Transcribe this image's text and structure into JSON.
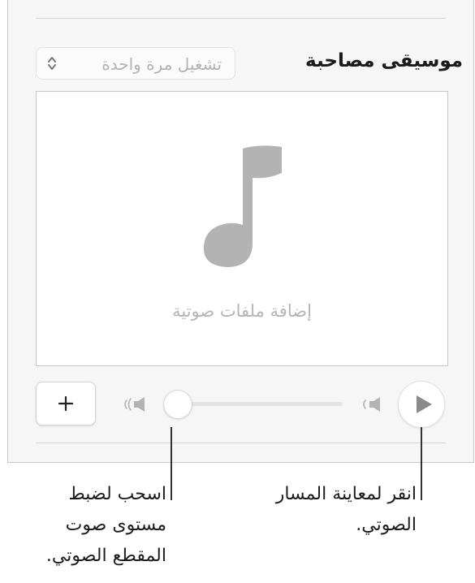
{
  "section": {
    "title": "موسيقى مصاحبة"
  },
  "playback_popup": {
    "selected": "تشغيل مرة واحدة",
    "icon": "chevron-updown-icon"
  },
  "dropzone": {
    "label": "إضافة ملفات صوتية",
    "icon": "music-note-icon"
  },
  "controls": {
    "add_icon": "plus-icon",
    "volume_low_icon": "speaker-low-icon",
    "volume_high_icon": "speaker-high-icon",
    "volume_level": 0.0,
    "play_icon": "play-icon"
  },
  "callouts": {
    "volume": [
      "اسحب لضبط",
      "مستوى صوت",
      "المقطع الصوتي."
    ],
    "play": [
      "انقر لمعاينة المسار",
      "الصوتي."
    ]
  },
  "colors": {
    "panel_bg": "#f6f6f6",
    "icon_gray": "#b3b3b3",
    "placeholder_text": "#b5b5b5",
    "play_gray": "#8a8a8a"
  }
}
